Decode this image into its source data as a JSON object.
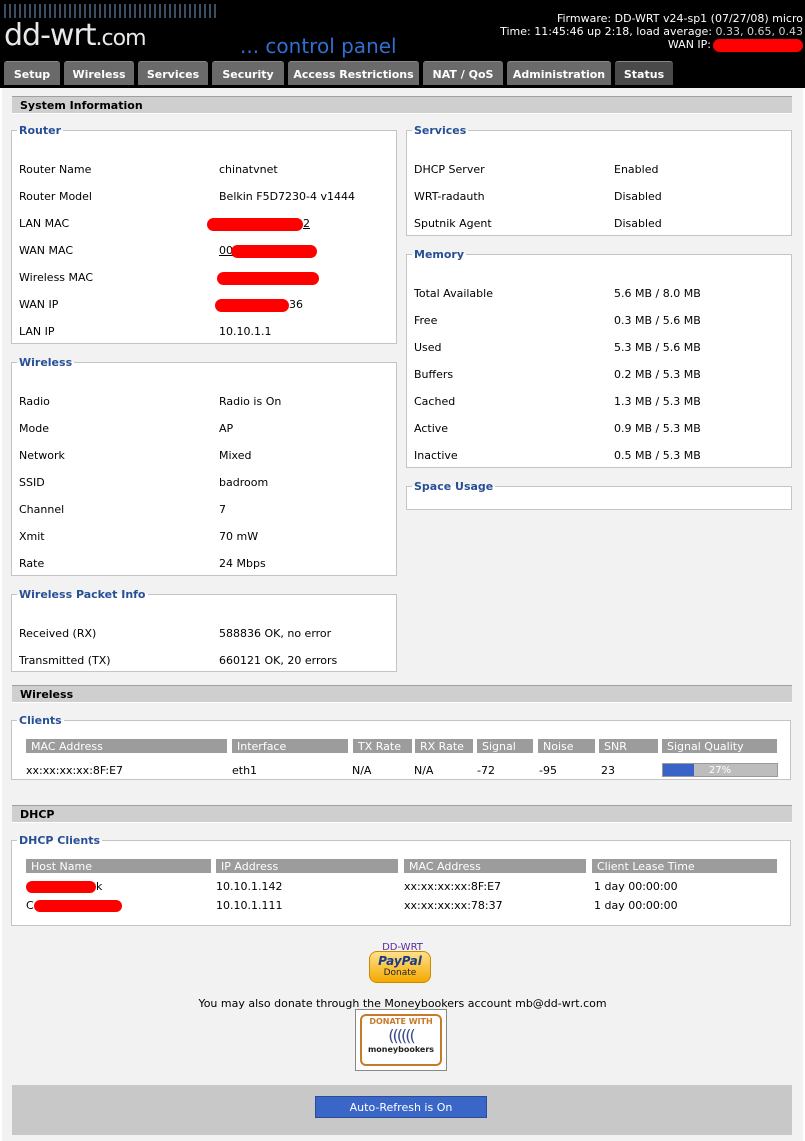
{
  "header": {
    "logo_text": "dd-wrt",
    "logo_suffix": ".com",
    "control_panel": "... control panel",
    "firmware_label": "Firmware:",
    "firmware_value": "DD-WRT v24-sp1 (07/27/08) micro",
    "time_label": "Time:",
    "time_value": "11:45:46 up 2:18, load average:",
    "load_value": "0.33, 0.65, 0.43",
    "wan_ip_label": "WAN IP:"
  },
  "tabs": [
    "Setup",
    "Wireless",
    "Services",
    "Security",
    "Access Restrictions",
    "NAT / QoS",
    "Administration",
    "Status"
  ],
  "system_info": {
    "title": "System Information",
    "router": {
      "legend": "Router",
      "rows": [
        {
          "label": "Router Name",
          "value": "chinatvnet"
        },
        {
          "label": "Router Model",
          "value": "Belkin F5D7230-4 v1444"
        },
        {
          "label": "LAN MAC",
          "value": "2"
        },
        {
          "label": "WAN MAC",
          "value": "00"
        },
        {
          "label": "Wireless MAC",
          "value": ""
        },
        {
          "label": "WAN IP",
          "value": "36"
        },
        {
          "label": "LAN IP",
          "value": "10.10.1.1"
        }
      ]
    },
    "services": {
      "legend": "Services",
      "rows": [
        {
          "label": "DHCP Server",
          "value": "Enabled"
        },
        {
          "label": "WRT-radauth",
          "value": "Disabled"
        },
        {
          "label": "Sputnik Agent",
          "value": "Disabled"
        }
      ]
    },
    "memory": {
      "legend": "Memory",
      "rows": [
        {
          "label": "Total Available",
          "value": "5.6 MB / 8.0 MB"
        },
        {
          "label": "Free",
          "value": "0.3 MB / 5.6 MB"
        },
        {
          "label": "Used",
          "value": "5.3 MB / 5.6 MB"
        },
        {
          "label": "Buffers",
          "value": "0.2 MB / 5.3 MB"
        },
        {
          "label": "Cached",
          "value": "1.3 MB / 5.3 MB"
        },
        {
          "label": "Active",
          "value": "0.9 MB / 5.3 MB"
        },
        {
          "label": "Inactive",
          "value": "0.5 MB / 5.3 MB"
        }
      ]
    },
    "space_usage": {
      "legend": "Space Usage"
    },
    "wireless": {
      "legend": "Wireless",
      "rows": [
        {
          "label": "Radio",
          "value": "Radio is On"
        },
        {
          "label": "Mode",
          "value": "AP"
        },
        {
          "label": "Network",
          "value": "Mixed"
        },
        {
          "label": "SSID",
          "value": "badroom"
        },
        {
          "label": "Channel",
          "value": "7"
        },
        {
          "label": "Xmit",
          "value": "70 mW"
        },
        {
          "label": "Rate",
          "value": "24 Mbps"
        }
      ]
    },
    "packet_info": {
      "legend": "Wireless Packet Info",
      "rows": [
        {
          "label": "Received (RX)",
          "value": "588836 OK, no error"
        },
        {
          "label": "Transmitted (TX)",
          "value": "660121 OK, 20 errors"
        }
      ]
    }
  },
  "wireless_section": {
    "title": "Wireless",
    "clients": {
      "legend": "Clients",
      "headers": [
        "MAC Address",
        "Interface",
        "TX Rate",
        "RX Rate",
        "Signal",
        "Noise",
        "SNR",
        "Signal Quality"
      ],
      "rows": [
        {
          "mac": "xx:xx:xx:xx:8F:E7",
          "interface": "eth1",
          "tx": "N/A",
          "rx": "N/A",
          "signal": "-72",
          "noise": "-95",
          "snr": "23",
          "quality_text": "27%",
          "quality_fraction": 0.27
        }
      ]
    }
  },
  "dhcp_section": {
    "title": "DHCP",
    "clients": {
      "legend": "DHCP Clients",
      "headers": [
        "Host Name",
        "IP Address",
        "MAC Address",
        "Client Lease Time"
      ],
      "rows": [
        {
          "host": "k",
          "ip": "10.10.1.142",
          "mac": "xx:xx:xx:xx:8F:E7",
          "lease": "1 day 00:00:00"
        },
        {
          "host": "C",
          "ip": "10.10.1.111",
          "mac": "xx:xx:xx:xx:78:37",
          "lease": "1 day 00:00:00"
        }
      ]
    }
  },
  "donate": {
    "ddwrt_link": "DD-WRT",
    "paypal_top": "PayPal",
    "paypal_bottom": "Donate",
    "moneybookers_text": "You may also donate through the Moneybookers account mb@dd-wrt.com",
    "mb_top": "DONATE WITH",
    "mb_bottom": "moneybookers"
  },
  "footer": {
    "refresh_label": "Auto-Refresh is On"
  },
  "colors": {
    "redaction": "#ff0000",
    "accent_blue": "#274f96",
    "button_blue": "#3a66c8"
  }
}
